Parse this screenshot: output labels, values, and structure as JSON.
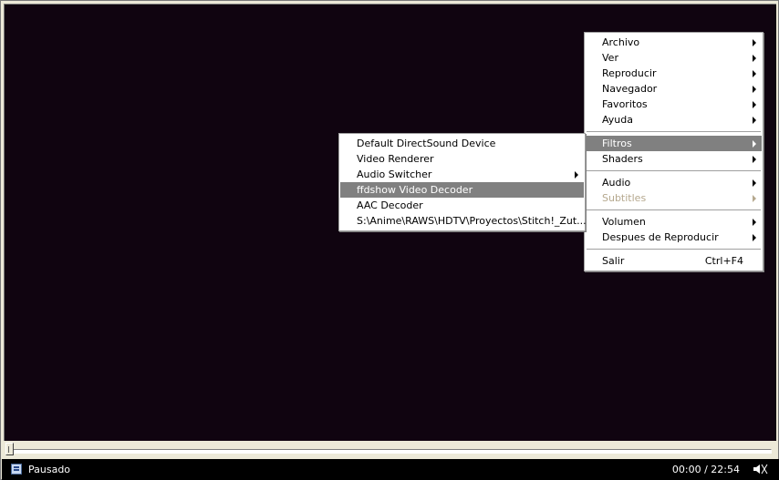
{
  "player": {
    "status": "Pausado",
    "time": "00:00 / 22:54"
  },
  "main_menu": {
    "groups": [
      [
        {
          "label": "Archivo",
          "arrow": true
        },
        {
          "label": "Ver",
          "arrow": true
        },
        {
          "label": "Reproducir",
          "arrow": true
        },
        {
          "label": "Navegador",
          "arrow": true
        },
        {
          "label": "Favoritos",
          "arrow": true
        },
        {
          "label": "Ayuda",
          "arrow": true
        }
      ],
      [
        {
          "label": "Filtros",
          "arrow": true,
          "highlight": true
        },
        {
          "label": "Shaders",
          "arrow": true
        }
      ],
      [
        {
          "label": "Audio",
          "arrow": true
        },
        {
          "label": "Subtitles",
          "arrow": true,
          "disabled": true
        }
      ],
      [
        {
          "label": "Volumen",
          "arrow": true
        },
        {
          "label": "Despues de Reproducir",
          "arrow": true
        }
      ],
      [
        {
          "label": "Salir",
          "shortcut": "Ctrl+F4"
        }
      ]
    ]
  },
  "filters_submenu": {
    "items": [
      {
        "label": "Default DirectSound Device"
      },
      {
        "label": "Video Renderer"
      },
      {
        "label": "Audio Switcher",
        "arrow": true
      },
      {
        "label": "ffdshow Video Decoder",
        "highlight": true
      },
      {
        "label": "AAC Decoder"
      },
      {
        "label": "S:\\Anime\\RAWS\\HDTV\\Proyectos\\Stitch!_Zut..."
      }
    ]
  },
  "icons": {
    "status": "player-status-icon",
    "speaker": "speaker-icon"
  }
}
